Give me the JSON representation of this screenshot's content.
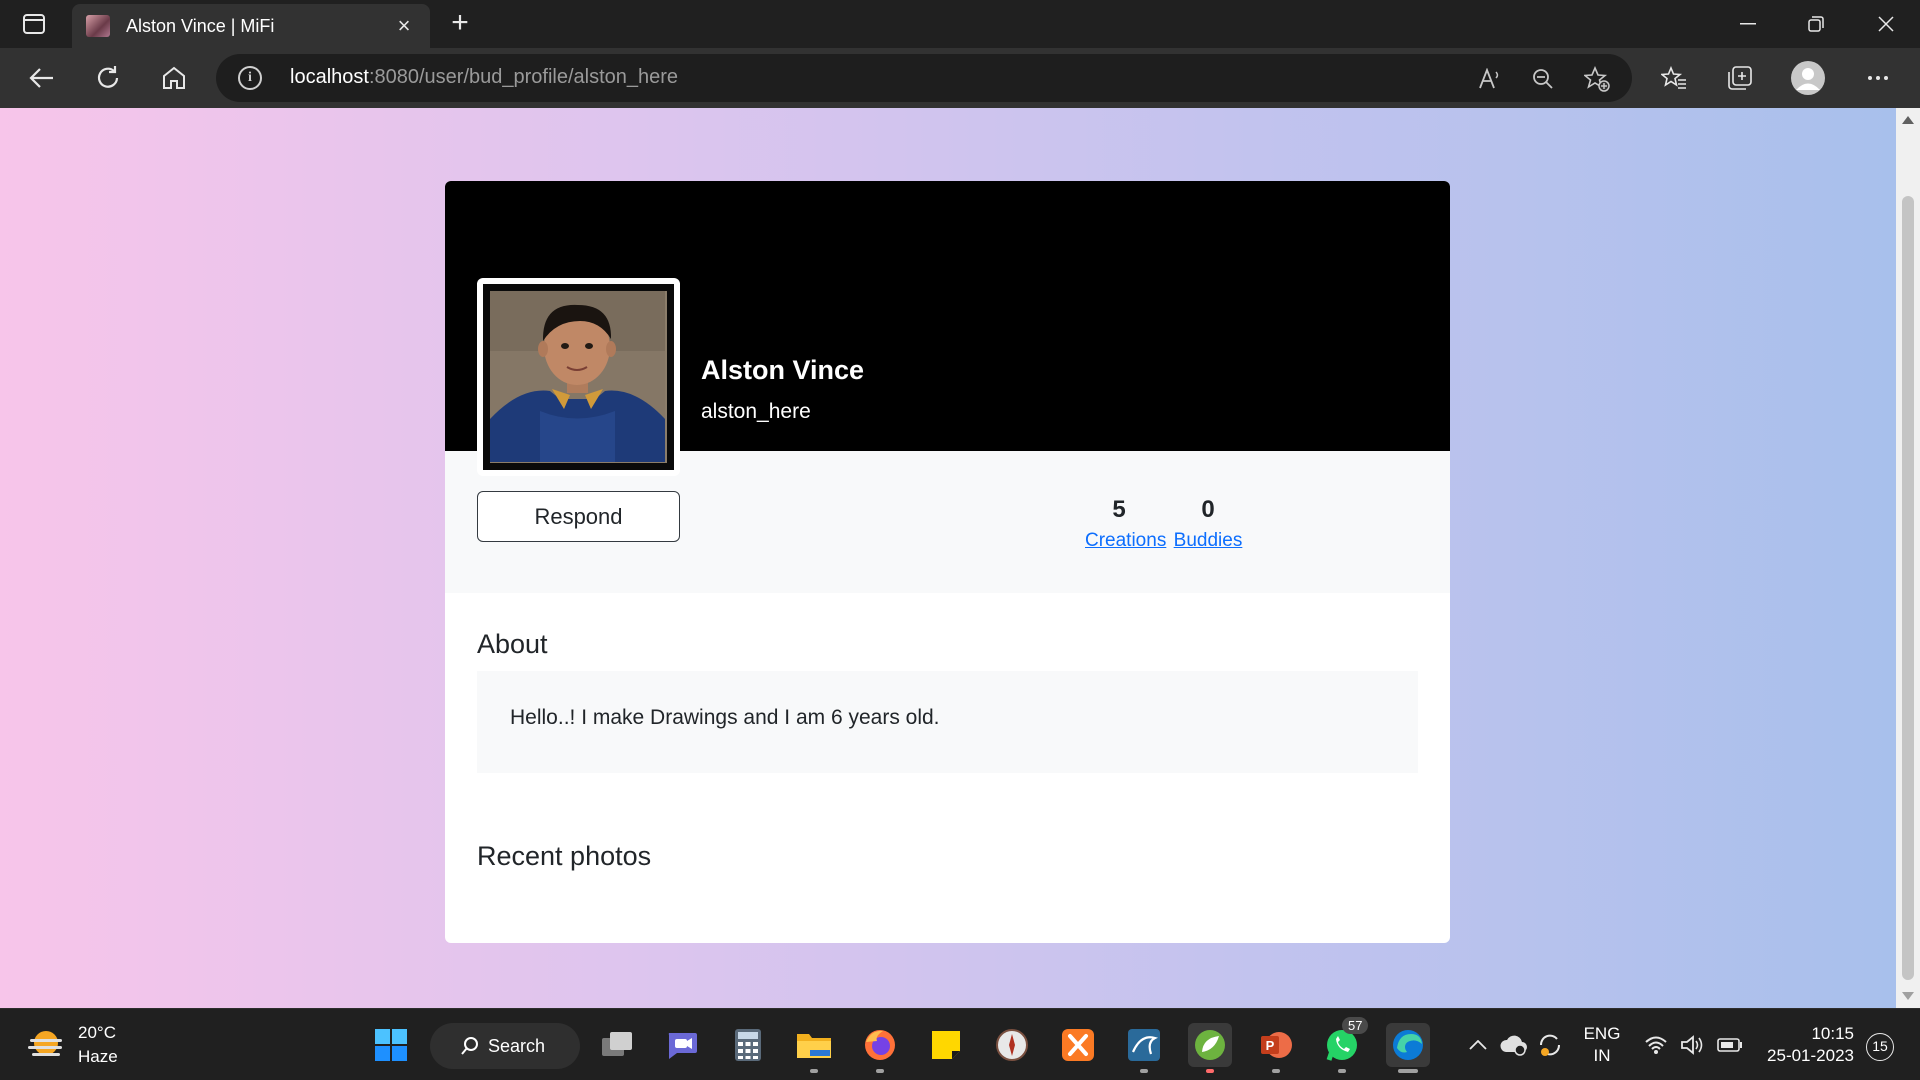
{
  "browser": {
    "tab_title": "Alston Vince | MiFi",
    "url_host": "localhost",
    "url_rest": ":8080/user/bud_profile/alston_here"
  },
  "profile": {
    "name": "Alston Vince",
    "username": "alston_here",
    "respond_label": "Respond",
    "stats": [
      {
        "value": "5",
        "label": "Creations"
      },
      {
        "value": "0",
        "label": "Buddies"
      }
    ],
    "about_heading": "About",
    "about_text": "Hello..! I make Drawings and I am 6 years old.",
    "recent_heading": "Recent photos"
  },
  "taskbar": {
    "weather_temp": "20°C",
    "weather_desc": "Haze",
    "search_label": "Search",
    "whatsapp_badge": "57",
    "lang_top": "ENG",
    "lang_bottom": "IN",
    "time": "10:15",
    "date": "25-01-2023",
    "notification_count": "15"
  },
  "colors": {
    "link": "#0d6efd",
    "cover": "#000000",
    "gradient_left": "#f7c5ea",
    "gradient_right": "#a8c0ec"
  }
}
